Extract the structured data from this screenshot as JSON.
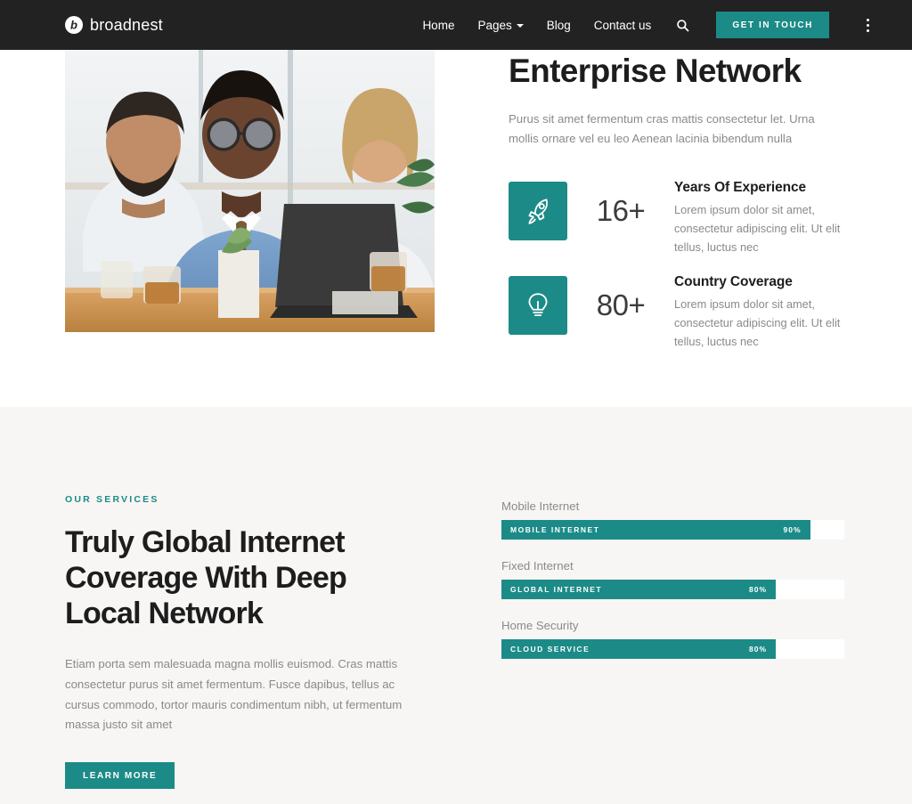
{
  "header": {
    "brand_mark": "b",
    "brand_name": "broadnest",
    "nav": [
      {
        "label": "Home",
        "has_caret": false
      },
      {
        "label": "Pages",
        "has_caret": true
      },
      {
        "label": "Blog",
        "has_caret": false
      },
      {
        "label": "Contact us",
        "has_caret": false
      }
    ],
    "search_icon": "search-icon",
    "cta_label": "GET IN TOUCH",
    "menu_icon": "kebab-menu-icon",
    "background": "#222222"
  },
  "hero": {
    "image_alt": "three business colleagues looking at a laptop at a table",
    "title": "Enterprise Network",
    "subtitle": "Purus sit amet fermentum cras mattis consectetur let. Urna mollis ornare vel eu leo Aenean lacinia bibendum nulla",
    "stats": [
      {
        "icon": "rocket-icon",
        "number": "16+",
        "title": "Years Of Experience",
        "description": "Lorem ipsum dolor sit amet, consectetur adipiscing elit. Ut elit tellus, luctus nec"
      },
      {
        "icon": "lightbulb-icon",
        "number": "80+",
        "title": "Country Coverage",
        "description": "Lorem ipsum dolor sit amet, consectetur adipiscing elit. Ut elit tellus, luctus nec"
      }
    ]
  },
  "services": {
    "eyebrow": "OUR SERVICES",
    "title": "Truly Global Internet Coverage With Deep Local Network",
    "copy": "Etiam porta sem malesuada magna mollis euismod. Cras mattis consectetur purus sit amet fermentum. Fusce dapibus, tellus ac cursus commodo, tortor mauris condimentum nibh, ut fermentum massa justo sit amet",
    "button_label": "LEARN MORE",
    "skills": [
      {
        "label": "Mobile Internet",
        "bar_name": "MOBILE INTERNET",
        "percent_label": "90%",
        "percent": 90
      },
      {
        "label": "Fixed Internet",
        "bar_name": "GLOBAL INTERNET",
        "percent_label": "80%",
        "percent": 80
      },
      {
        "label": "Home Security",
        "bar_name": "CLOUD SERVICE",
        "percent_label": "80%",
        "percent": 80
      }
    ],
    "background": "#f7f6f4"
  },
  "theme": {
    "accent": "#1c8b87",
    "dark": "#222222",
    "muted_text": "#8a8a8a",
    "heading": "#1d1d1d"
  }
}
